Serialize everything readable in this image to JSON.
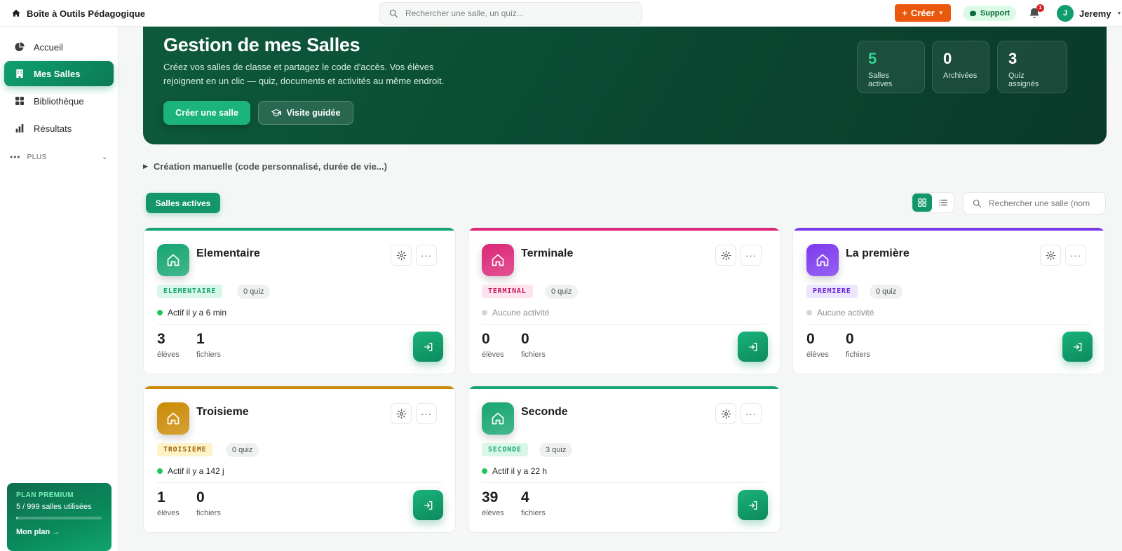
{
  "app": {
    "title": "Boîte à Outils Pédagogique"
  },
  "topbar": {
    "search_placeholder": "Rechercher une salle, un quiz...",
    "create_label": "Créer",
    "support_label": "Support",
    "notifications_count": "1",
    "user_initial": "J",
    "user_name": "Jeremy"
  },
  "sidebar": {
    "items": [
      {
        "label": "Accueil",
        "icon": "pie-chart-icon"
      },
      {
        "label": "Mes Salles",
        "icon": "building-icon",
        "active": true
      },
      {
        "label": "Bibliothèque",
        "icon": "grid-icon"
      },
      {
        "label": "Résultats",
        "icon": "bar-chart-icon"
      }
    ],
    "more_label": "PLUS",
    "plan": {
      "title": "PLAN PREMIUM",
      "usage": "5 / 999 salles utilisées",
      "usage_fraction": 0.005,
      "link": "Mon plan →"
    }
  },
  "hero": {
    "title": "Gestion de mes Salles",
    "description": "Créez vos salles de classe et partagez le code d'accès. Vos élèves rejoignent en un clic — quiz, documents et activités au même endroit.",
    "primary_button": "Créer une salle",
    "secondary_button": "Visite guidée",
    "stats": [
      {
        "value": "5",
        "label": "Salles actives",
        "color": "#34d399"
      },
      {
        "value": "0",
        "label": "Archivées",
        "color": "#ffffff"
      },
      {
        "value": "3",
        "label": "Quiz assignés",
        "color": "#ffffff"
      }
    ]
  },
  "manual_toggle": "Création manuelle (code personnalisé, durée de vie...)",
  "tabs": {
    "active_label": "Salles actives"
  },
  "room_search_placeholder": "Rechercher une salle (nom",
  "labels": {
    "students": "élèves",
    "files": "fichiers"
  },
  "rooms": [
    {
      "name": "Elementaire",
      "code": "ELEMENTAIRE",
      "quiz": "0 quiz",
      "activity": "Actif il y a 6 min",
      "active": true,
      "students": "3",
      "files": "1",
      "accent": "#16a571",
      "code_bg": "#d9f7e8",
      "code_fg": "#16a571"
    },
    {
      "name": "Terminale",
      "code": "TERMINAL",
      "quiz": "0 quiz",
      "activity": "Aucune activité",
      "active": false,
      "students": "0",
      "files": "0",
      "accent": "#db2777",
      "code_bg": "#fde3ee",
      "code_fg": "#c2185b"
    },
    {
      "name": "La première",
      "code": "PREMIERE",
      "quiz": "0 quiz",
      "activity": "Aucune activité",
      "active": false,
      "students": "0",
      "files": "0",
      "accent": "#7c3aed",
      "code_bg": "#ede4fd",
      "code_fg": "#6d28d9"
    },
    {
      "name": "Troisieme",
      "code": "TROISIEME",
      "quiz": "0 quiz",
      "activity": "Actif il y a 142 j",
      "active": true,
      "students": "1",
      "files": "0",
      "accent": "#ca8a04",
      "code_bg": "#fdf3c8",
      "code_fg": "#a16207"
    },
    {
      "name": "Seconde",
      "code": "SECONDE",
      "quiz": "3 quiz",
      "activity": "Actif il y a 22 h",
      "active": true,
      "students": "39",
      "files": "4",
      "accent": "#16a571",
      "code_bg": "#d9f7e8",
      "code_fg": "#16a571"
    }
  ]
}
